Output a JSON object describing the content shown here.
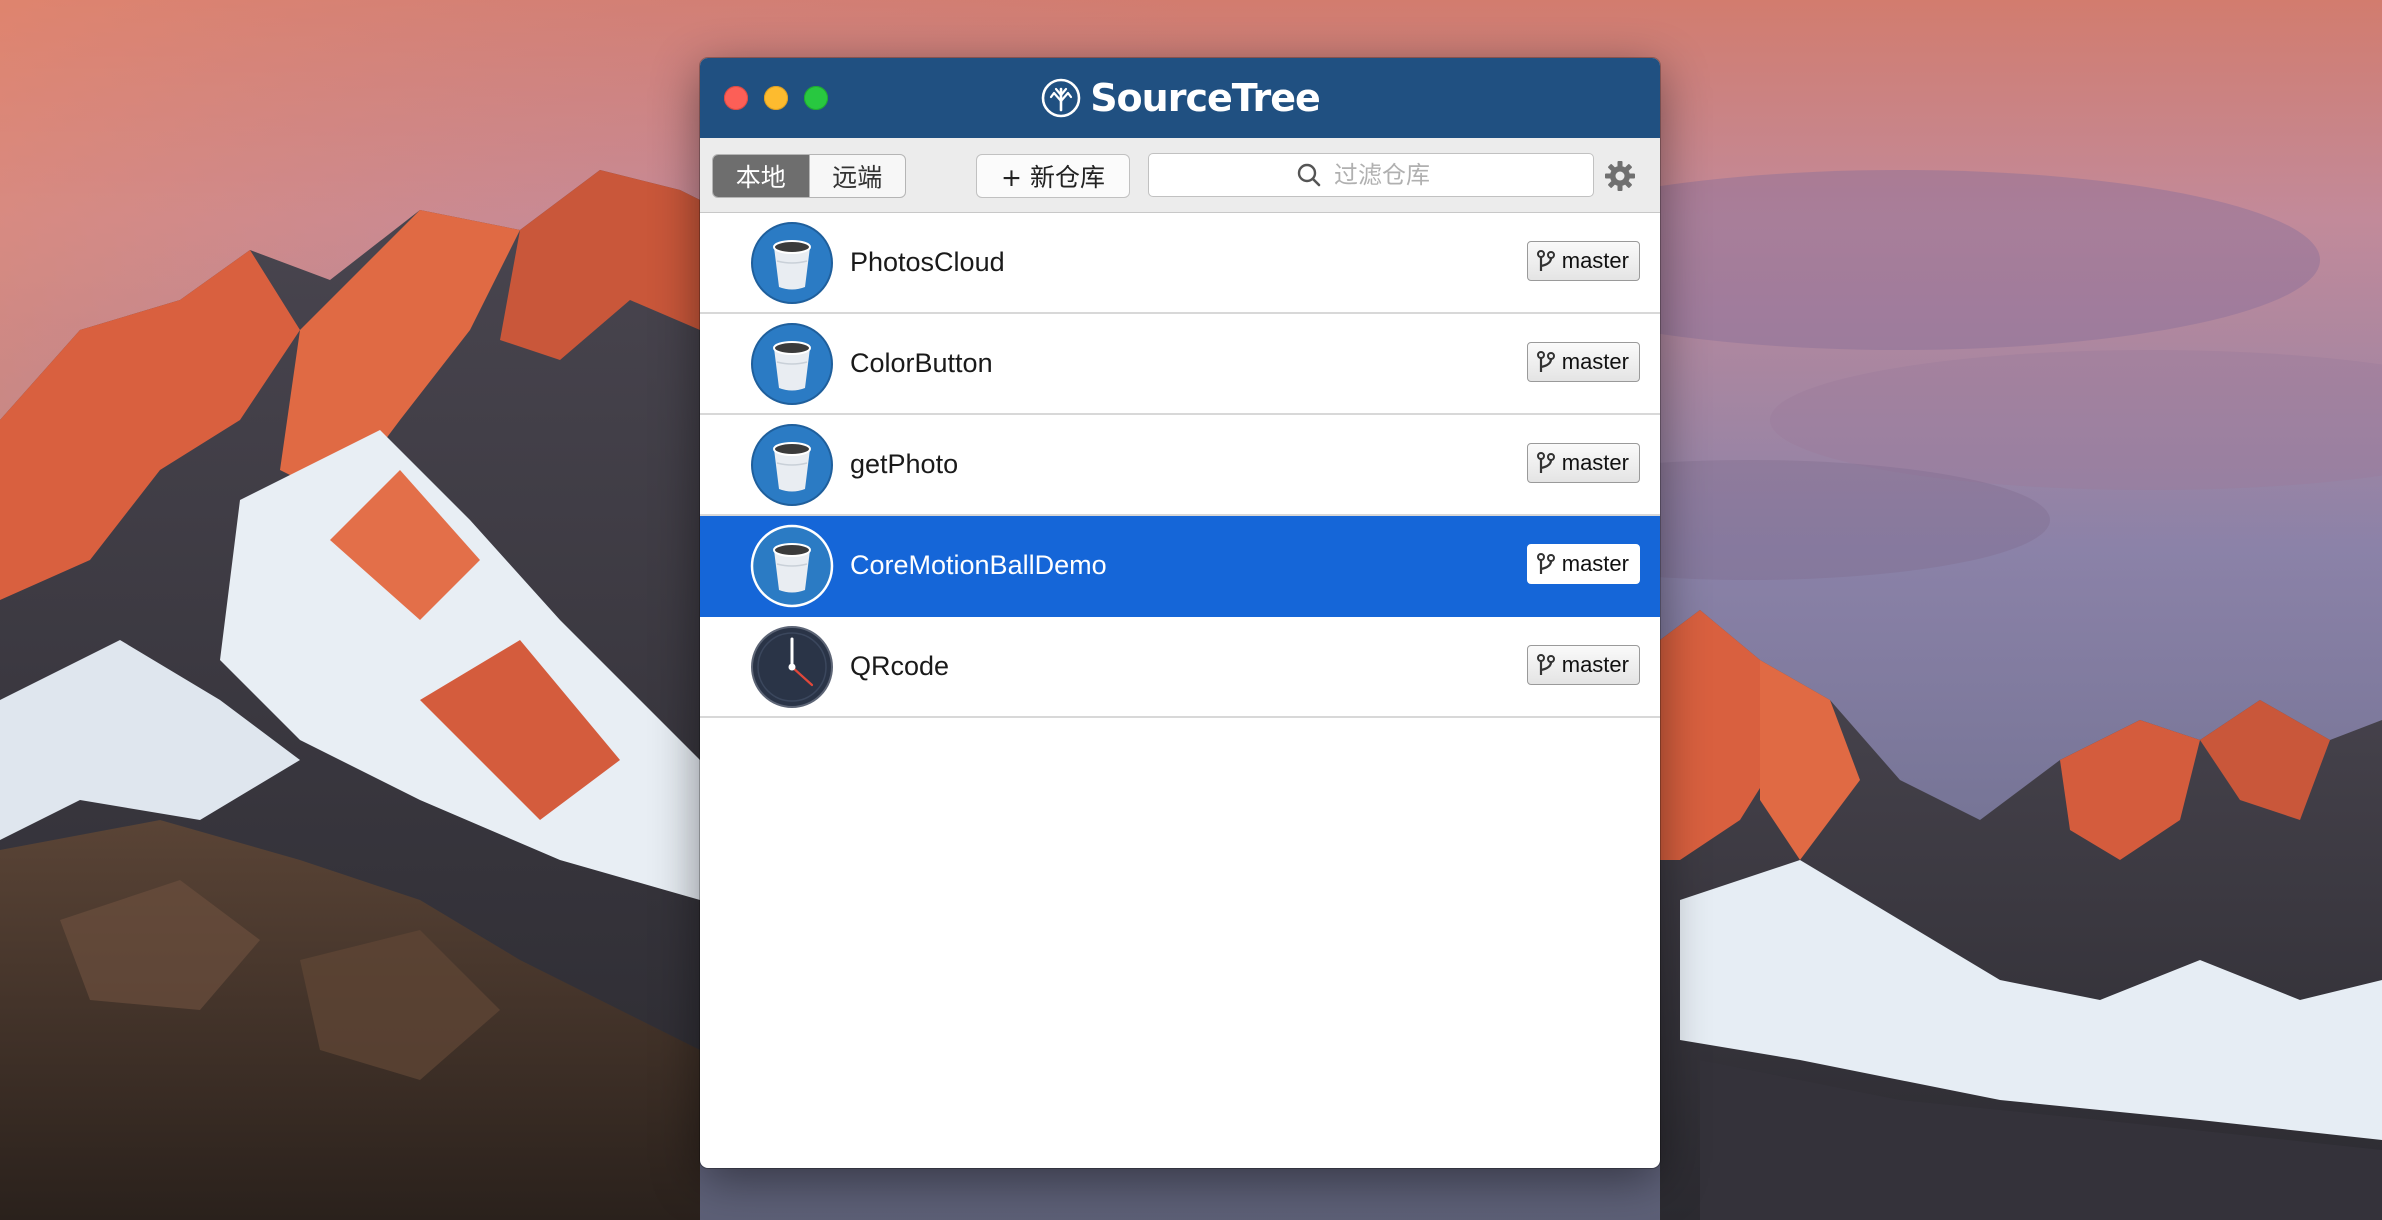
{
  "window": {
    "brand_name": "SourceTree"
  },
  "toolbar": {
    "tabs": [
      {
        "label": "本地",
        "active": true
      },
      {
        "label": "远端",
        "active": false
      }
    ],
    "new_repo_label": "+ 新仓库",
    "search_placeholder": "过滤仓库"
  },
  "repos": [
    {
      "name": "PhotosCloud",
      "branch": "master",
      "icon": "bucket-icon",
      "selected": false
    },
    {
      "name": "ColorButton",
      "branch": "master",
      "icon": "bucket-icon",
      "selected": false
    },
    {
      "name": "getPhoto",
      "branch": "master",
      "icon": "bucket-icon",
      "selected": false
    },
    {
      "name": "CoreMotionBallDemo",
      "branch": "master",
      "icon": "bucket-icon",
      "selected": true
    },
    {
      "name": "QRcode",
      "branch": "master",
      "icon": "clock-icon",
      "selected": false
    }
  ],
  "colors": {
    "titlebar": "#205081",
    "selection": "#1566d8",
    "bucket_circle": "#2b7bc4",
    "clock_circle": "#2a3447"
  }
}
